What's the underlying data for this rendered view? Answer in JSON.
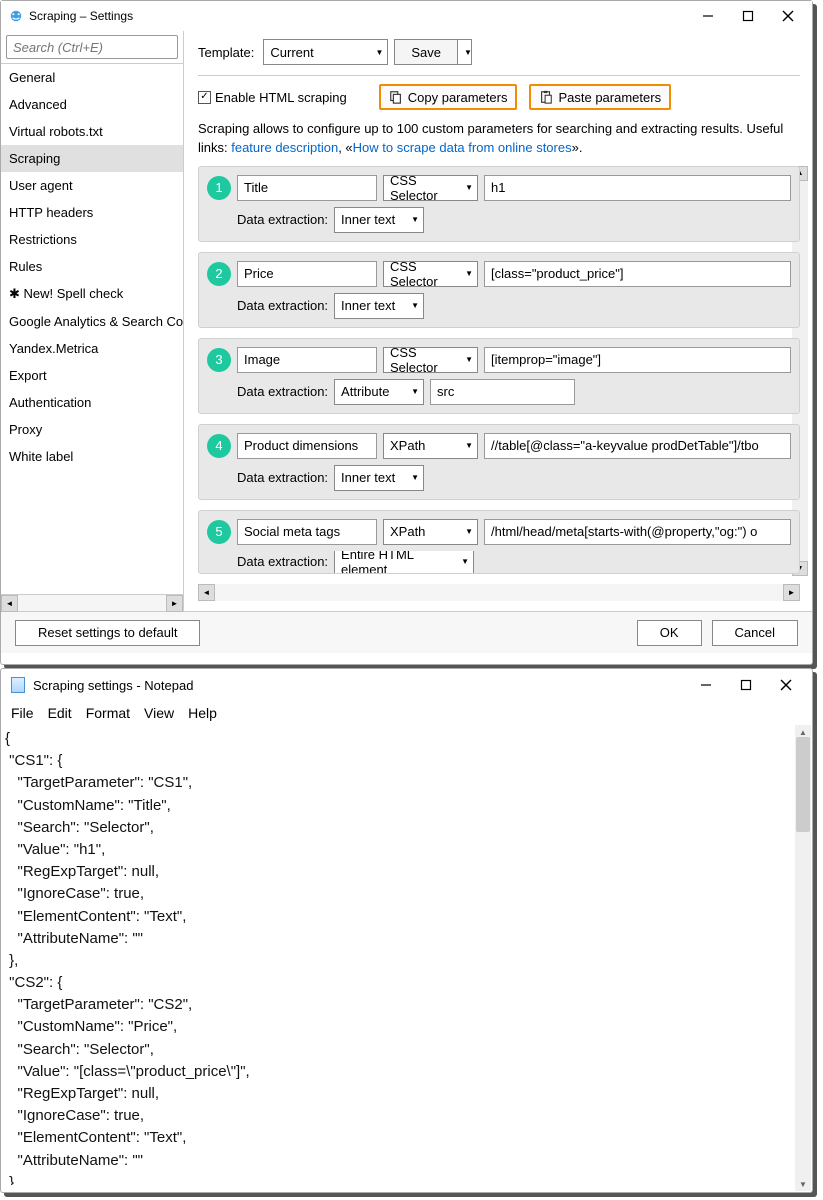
{
  "win1": {
    "title": "Scraping – Settings",
    "search_placeholder": "Search (Ctrl+E)",
    "sidebar": [
      "General",
      "Advanced",
      "Virtual robots.txt",
      "Scraping",
      "User agent",
      "HTTP headers",
      "Restrictions",
      "Rules",
      "✱ New! Spell check",
      "Google Analytics & Search Co",
      "Yandex.Metrica",
      "Export",
      "Authentication",
      "Proxy",
      "White label"
    ],
    "sidebar_selected": 3,
    "template_label": "Template:",
    "template_value": "Current",
    "save_label": "Save",
    "enable_label": "Enable HTML scraping",
    "enable_checked": true,
    "copy_btn": "Copy parameters",
    "paste_btn": "Paste parameters",
    "desc_1": "Scraping allows to configure up to 100 custom parameters for searching and extracting results. Useful links: ",
    "link_feature": "feature description",
    "desc_mid": ", «",
    "link_howto": "How to scrape data from online stores",
    "desc_end": "».",
    "data_extraction_label": "Data extraction:",
    "rules": [
      {
        "n": "1",
        "name": "Title",
        "seltype": "CSS Selector",
        "sel": "h1",
        "extract": "Inner text",
        "attr": null
      },
      {
        "n": "2",
        "name": "Price",
        "seltype": "CSS Selector",
        "sel": "[class=\"product_price\"]",
        "extract": "Inner text",
        "attr": null
      },
      {
        "n": "3",
        "name": "Image",
        "seltype": "CSS Selector",
        "sel": "[itemprop=\"image\"]",
        "extract": "Attribute",
        "attr": "src"
      },
      {
        "n": "4",
        "name": "Product dimensions",
        "seltype": "XPath",
        "sel": "//table[@class=\"a-keyvalue prodDetTable\"]/tbo",
        "extract": "Inner text",
        "attr": null
      },
      {
        "n": "5",
        "name": "Social meta tags",
        "seltype": "XPath",
        "sel": "/html/head/meta[starts-with(@property,\"og:\") o",
        "extract": "Entire HTML element",
        "attr": null
      }
    ],
    "reset_label": "Reset settings to default",
    "ok_label": "OK",
    "cancel_label": "Cancel"
  },
  "win2": {
    "title": "Scraping settings - Notepad",
    "menu": [
      "File",
      "Edit",
      "Format",
      "View",
      "Help"
    ],
    "body": "{\n \"CS1\": {\n   \"TargetParameter\": \"CS1\",\n   \"CustomName\": \"Title\",\n   \"Search\": \"Selector\",\n   \"Value\": \"h1\",\n   \"RegExpTarget\": null,\n   \"IgnoreCase\": true,\n   \"ElementContent\": \"Text\",\n   \"AttributeName\": \"\"\n },\n \"CS2\": {\n   \"TargetParameter\": \"CS2\",\n   \"CustomName\": \"Price\",\n   \"Search\": \"Selector\",\n   \"Value\": \"[class=\\\"product_price\\\"]\",\n   \"RegExpTarget\": null,\n   \"IgnoreCase\": true,\n   \"ElementContent\": \"Text\",\n   \"AttributeName\": \"\"\n },"
  }
}
